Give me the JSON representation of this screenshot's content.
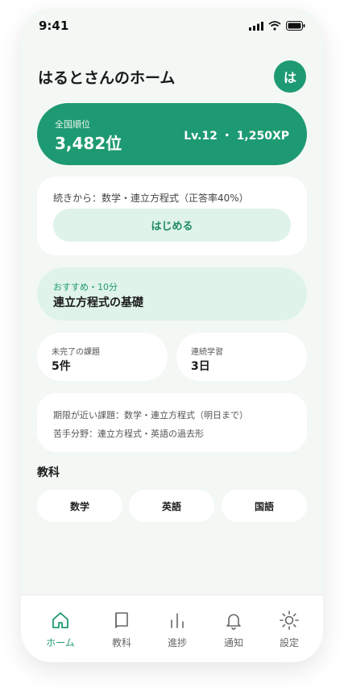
{
  "status_bar": {
    "time": "9:41"
  },
  "header": {
    "title": "はるとさんのホーム",
    "avatar_initial": "は"
  },
  "rank": {
    "label": "全国順位",
    "value": "3,482位",
    "level_xp": "Lv.12 ・ 1,250XP"
  },
  "continue": {
    "text": "続きから：数学・連立方程式（正答率40%）",
    "button_label": "はじめる"
  },
  "recommendation": {
    "tag": "おすすめ・10分",
    "title": "連立方程式の基礎"
  },
  "stats": [
    {
      "label": "未完了の課題",
      "value": "5件"
    },
    {
      "label": "連続学習",
      "value": "3日"
    }
  ],
  "notices": [
    "期限が近い課題：数学・連立方程式（明日まで）",
    "苦手分野：連立方程式・英語の過去形"
  ],
  "subjects": {
    "title": "教科",
    "items": [
      "数学",
      "英語",
      "国語"
    ]
  },
  "tabs": [
    {
      "label": "ホーム",
      "icon": "home-icon",
      "active": true
    },
    {
      "label": "教科",
      "icon": "book-icon",
      "active": false
    },
    {
      "label": "進捗",
      "icon": "bar-chart-icon",
      "active": false
    },
    {
      "label": "通知",
      "icon": "bell-icon",
      "active": false
    },
    {
      "label": "設定",
      "icon": "gear-icon",
      "active": false
    }
  ],
  "colors": {
    "accent": "#1e9a72",
    "accent_light": "#dff3e9",
    "background": "#f3f8f5"
  }
}
